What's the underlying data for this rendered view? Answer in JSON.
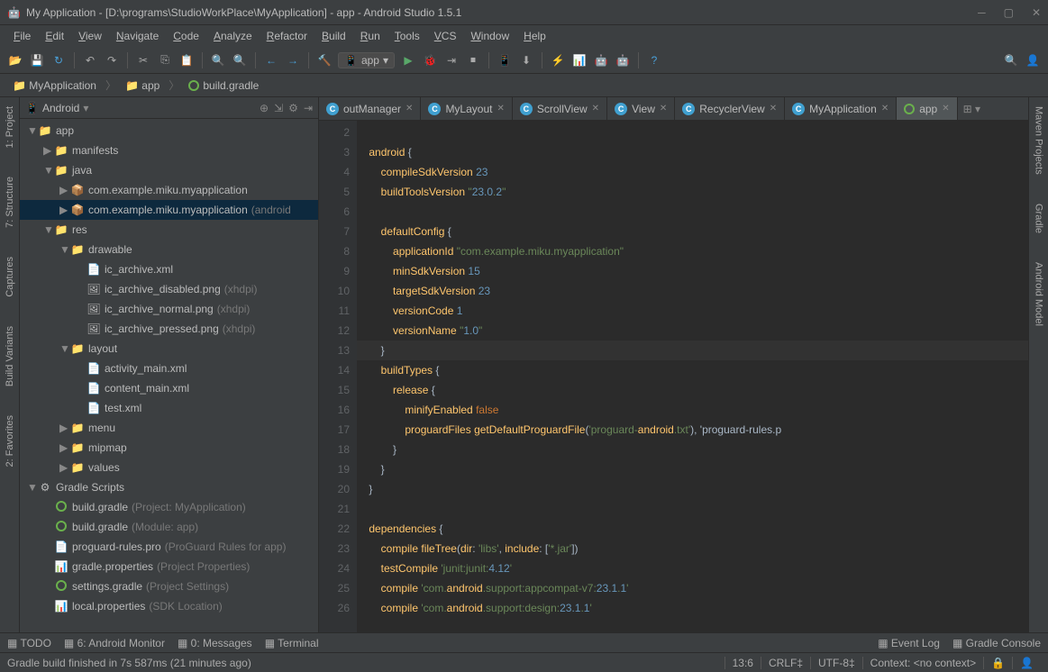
{
  "window": {
    "title": "My Application - [D:\\programs\\StudioWorkPlace\\MyApplication] - app - Android Studio 1.5.1"
  },
  "menu": [
    "File",
    "Edit",
    "View",
    "Navigate",
    "Code",
    "Analyze",
    "Refactor",
    "Build",
    "Run",
    "Tools",
    "VCS",
    "Window",
    "Help"
  ],
  "runConfig": "app",
  "breadcrumbs": [
    {
      "label": "MyApplication",
      "icon": "folder"
    },
    {
      "label": "app",
      "icon": "folder"
    },
    {
      "label": "build.gradle",
      "icon": "gradle"
    }
  ],
  "projectPanel": {
    "viewMode": "Android"
  },
  "tree": [
    {
      "d": 0,
      "arrow": "▼",
      "icon": "📁",
      "label": "app",
      "cls": "folder-icon bold"
    },
    {
      "d": 1,
      "arrow": "▶",
      "icon": "📁",
      "label": "manifests",
      "cls": "folder-icon"
    },
    {
      "d": 1,
      "arrow": "▼",
      "icon": "📁",
      "label": "java",
      "cls": "folder-icon"
    },
    {
      "d": 2,
      "arrow": "▶",
      "icon": "📦",
      "label": "com.example.miku.myapplication",
      "cls": ""
    },
    {
      "d": 2,
      "arrow": "▶",
      "icon": "📦",
      "label": "com.example.miku.myapplication",
      "dim": "(android",
      "sel": true
    },
    {
      "d": 1,
      "arrow": "▼",
      "icon": "📁",
      "label": "res",
      "cls": "folder-icon"
    },
    {
      "d": 2,
      "arrow": "▼",
      "icon": "📁",
      "label": "drawable",
      "cls": "folder-icon"
    },
    {
      "d": 3,
      "arrow": "",
      "icon": "📄",
      "label": "ic_archive.xml",
      "cls": ""
    },
    {
      "d": 3,
      "arrow": "",
      "icon": "🖼",
      "label": "ic_archive_disabled.png",
      "dim": "(xhdpi)"
    },
    {
      "d": 3,
      "arrow": "",
      "icon": "🖼",
      "label": "ic_archive_normal.png",
      "dim": "(xhdpi)"
    },
    {
      "d": 3,
      "arrow": "",
      "icon": "🖼",
      "label": "ic_archive_pressed.png",
      "dim": "(xhdpi)"
    },
    {
      "d": 2,
      "arrow": "▼",
      "icon": "📁",
      "label": "layout",
      "cls": "folder-icon"
    },
    {
      "d": 3,
      "arrow": "",
      "icon": "📄",
      "label": "activity_main.xml",
      "cls": ""
    },
    {
      "d": 3,
      "arrow": "",
      "icon": "📄",
      "label": "content_main.xml",
      "cls": ""
    },
    {
      "d": 3,
      "arrow": "",
      "icon": "📄",
      "label": "test.xml",
      "cls": ""
    },
    {
      "d": 2,
      "arrow": "▶",
      "icon": "📁",
      "label": "menu",
      "cls": "folder-icon"
    },
    {
      "d": 2,
      "arrow": "▶",
      "icon": "📁",
      "label": "mipmap",
      "cls": "folder-icon"
    },
    {
      "d": 2,
      "arrow": "▶",
      "icon": "📁",
      "label": "values",
      "cls": "folder-icon"
    },
    {
      "d": 0,
      "arrow": "▼",
      "icon": "⚙",
      "label": "Gradle Scripts",
      "cls": ""
    },
    {
      "d": 1,
      "arrow": "",
      "icon": "◉",
      "label": "build.gradle",
      "dim": "(Project: MyApplication)",
      "iconCls": "gradle"
    },
    {
      "d": 1,
      "arrow": "",
      "icon": "◉",
      "label": "build.gradle",
      "dim": "(Module: app)",
      "iconCls": "gradle"
    },
    {
      "d": 1,
      "arrow": "",
      "icon": "📄",
      "label": "proguard-rules.pro",
      "dim": "(ProGuard Rules for app)"
    },
    {
      "d": 1,
      "arrow": "",
      "icon": "📊",
      "label": "gradle.properties",
      "dim": "(Project Properties)"
    },
    {
      "d": 1,
      "arrow": "",
      "icon": "◉",
      "label": "settings.gradle",
      "dim": "(Project Settings)",
      "iconCls": "gradle"
    },
    {
      "d": 1,
      "arrow": "",
      "icon": "📊",
      "label": "local.properties",
      "dim": "(SDK Location)"
    }
  ],
  "tabs": [
    {
      "label": "outManager",
      "icon": "c",
      "partial": true
    },
    {
      "label": "MyLayout",
      "icon": "c"
    },
    {
      "label": "ScrollView",
      "icon": "c"
    },
    {
      "label": "View",
      "icon": "c"
    },
    {
      "label": "RecyclerView",
      "icon": "c"
    },
    {
      "label": "MyApplication",
      "icon": "c"
    },
    {
      "label": "app",
      "icon": "gradle",
      "active": true
    }
  ],
  "tabMore": "⊞ ▾",
  "code": {
    "startLine": 2,
    "highlightLine": 13,
    "lines": [
      "",
      "android {",
      "    compileSdkVersion 23",
      "    buildToolsVersion \"23.0.2\"",
      "",
      "    defaultConfig {",
      "        applicationId \"com.example.miku.myapplication\"",
      "        minSdkVersion 15",
      "        targetSdkVersion 23",
      "        versionCode 1",
      "        versionName \"1.0\"",
      "    }",
      "    buildTypes {",
      "        release {",
      "            minifyEnabled false",
      "            proguardFiles getDefaultProguardFile('proguard-android.txt'), 'proguard-rules.p",
      "        }",
      "    }",
      "}",
      "",
      "dependencies {",
      "    compile fileTree(dir: 'libs', include: ['*.jar'])",
      "    testCompile 'junit:junit:4.12'",
      "    compile 'com.android.support:appcompat-v7:23.1.1'",
      "    compile 'com.android.support:design:23.1.1'"
    ]
  },
  "leftTabs": [
    "1: Project",
    "7: Structure",
    "Captures",
    "Build Variants",
    "2: Favorites"
  ],
  "rightTabs": [
    "Maven Projects",
    "Gradle",
    "Android Model"
  ],
  "bottomBar": {
    "items": [
      "TODO",
      "6: Android Monitor",
      "0: Messages",
      "Terminal"
    ],
    "right": [
      "Event Log",
      "Gradle Console"
    ]
  },
  "status": {
    "message": "Gradle build finished in 7s 587ms (21 minutes ago)",
    "pos": "13:6",
    "eol": "CRLF‡",
    "enc": "UTF-8‡",
    "context": "Context: <no context>",
    "lock": "🔒"
  }
}
